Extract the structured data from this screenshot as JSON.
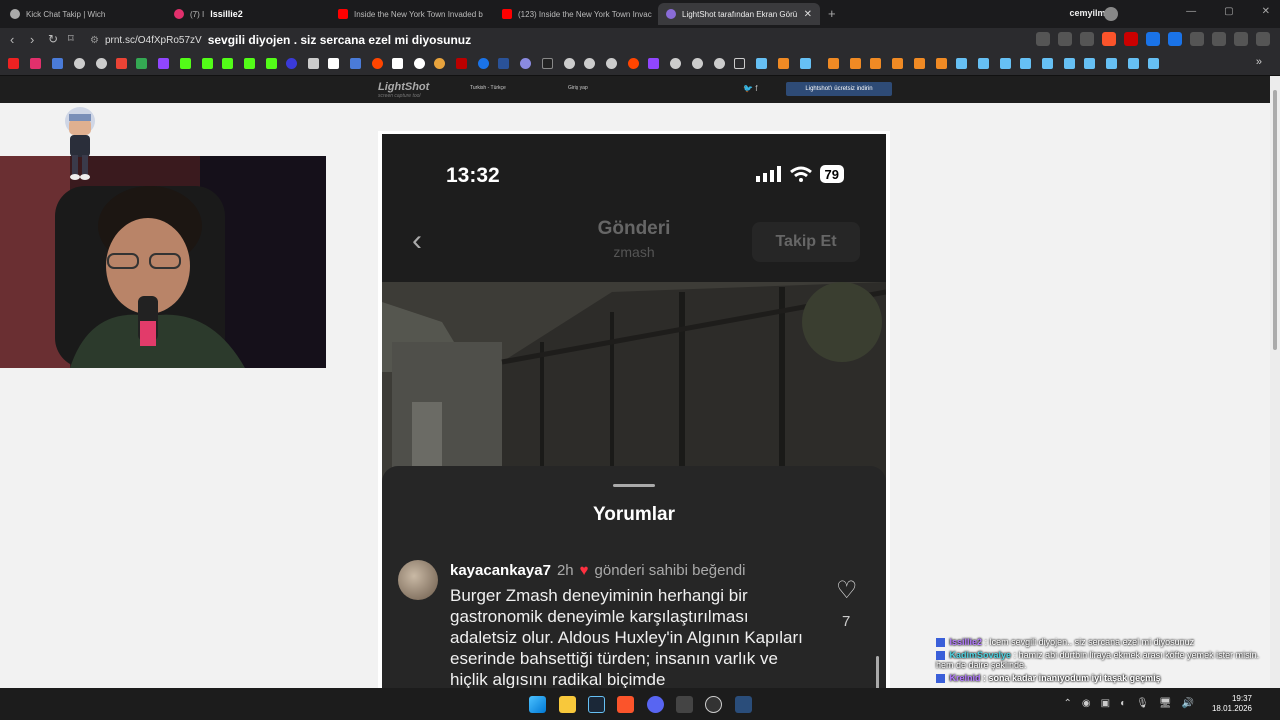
{
  "browser": {
    "tabs": [
      {
        "title": "Kick Chat Takip | Wich",
        "active": false,
        "color": "#aaaaaa"
      },
      {
        "title": "(7) I",
        "active": false,
        "color": "#e1306c"
      },
      {
        "title": "Inside the New York Town Invaded b",
        "active": false,
        "color": "#ff0000"
      },
      {
        "title": "(123) Inside the New York Town Invac",
        "active": false,
        "color": "#ff0000"
      },
      {
        "title": "LightShot tarafından Ekran Görü",
        "active": true,
        "color": "#8a6cd8"
      }
    ],
    "overlay_user": "lssillie2",
    "profile_name": "cemyilmaz",
    "url": "prnt.sc/O4fXpRo57zV",
    "url_overlay_text": "sevgili diyojen . siz sercana ezel mi diyosunuz",
    "close_glyph": "✕",
    "newtab_glyph": "+"
  },
  "lightshot": {
    "logo": "LightShot",
    "tagline": "screen capture tool",
    "language": "Turkish - Türkçe",
    "login": "Giriş yap",
    "download": "Lightshot'ı ücretsiz indirin"
  },
  "post": {
    "status_time": "13:32",
    "battery": "79",
    "title": "Gönderi",
    "username": "zmash",
    "follow": "Takip Et",
    "comments_title": "Yorumlar",
    "comment": {
      "user": "kayacankaya7",
      "time": "2h",
      "liked_by_author": "gönderi sahibi beğendi",
      "text": "Burger Zmash deneyiminin herhangi bir gastronomik deneyimle karşılaştırılması adaletsiz olur. Aldous Huxley'in Algının Kapıları eserinde bahsettiği türden; insanın varlık ve hiçlik algısını radikal biçimde",
      "likes": "7"
    }
  },
  "chat": [
    {
      "user": "lssillie2",
      "message": ": lcem sevgili diyojen.. siz sercana ezel mi diyosunuz"
    },
    {
      "user": "KadimSovalye",
      "message": ": hamiz abi dürtbin liraya ekmek arası köfte yemek ister misin. hem de daire şeklinde."
    },
    {
      "user": "Krelnid",
      "message": ": sona kadar inanıyodum iyi taşak geçmiş"
    }
  ],
  "taskbar": {
    "time": "19:37",
    "date": "18.01.2026"
  }
}
